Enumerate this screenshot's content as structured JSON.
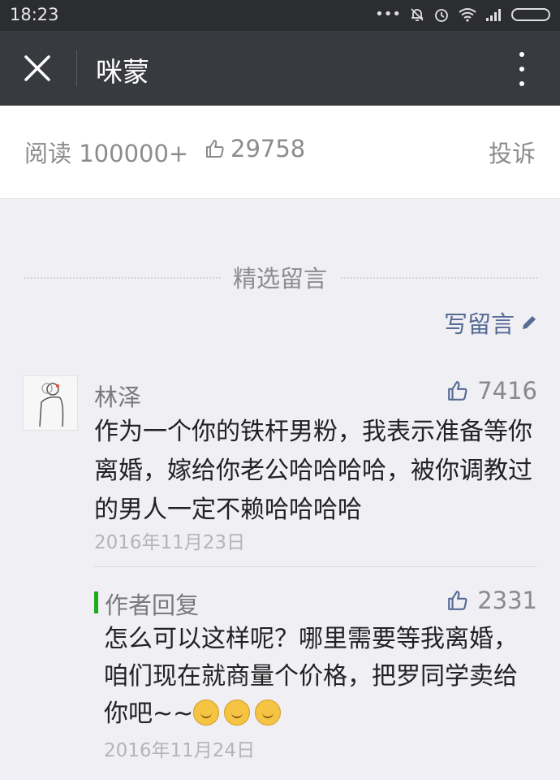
{
  "status_bar": {
    "time": "18:23"
  },
  "header": {
    "title": "咪蒙"
  },
  "stats": {
    "reads": "阅读 100000+",
    "likes": "29758",
    "report": "投诉"
  },
  "section": {
    "title": "精选留言",
    "write_label": "写留言"
  },
  "comment": {
    "author": "林泽",
    "likes": "7416",
    "text": "作为一个你的铁杆男粉，我表示准备等你离婚，嫁给你老公哈哈哈哈，被你调教过的男人一定不赖哈哈哈哈",
    "date": "2016年11月23日"
  },
  "reply": {
    "label": "作者回复",
    "likes": "2331",
    "text": "怎么可以这样呢？哪里需要等我离婚，咱们现在就商量个价格，把罗同学卖给你吧~~",
    "emoji_icon": "thinking-face-icon",
    "date": "2016年11月24日"
  },
  "colors": {
    "accent_link": "#576b95",
    "reply_bar": "#1aad19",
    "titlebar": "#393a3f"
  }
}
